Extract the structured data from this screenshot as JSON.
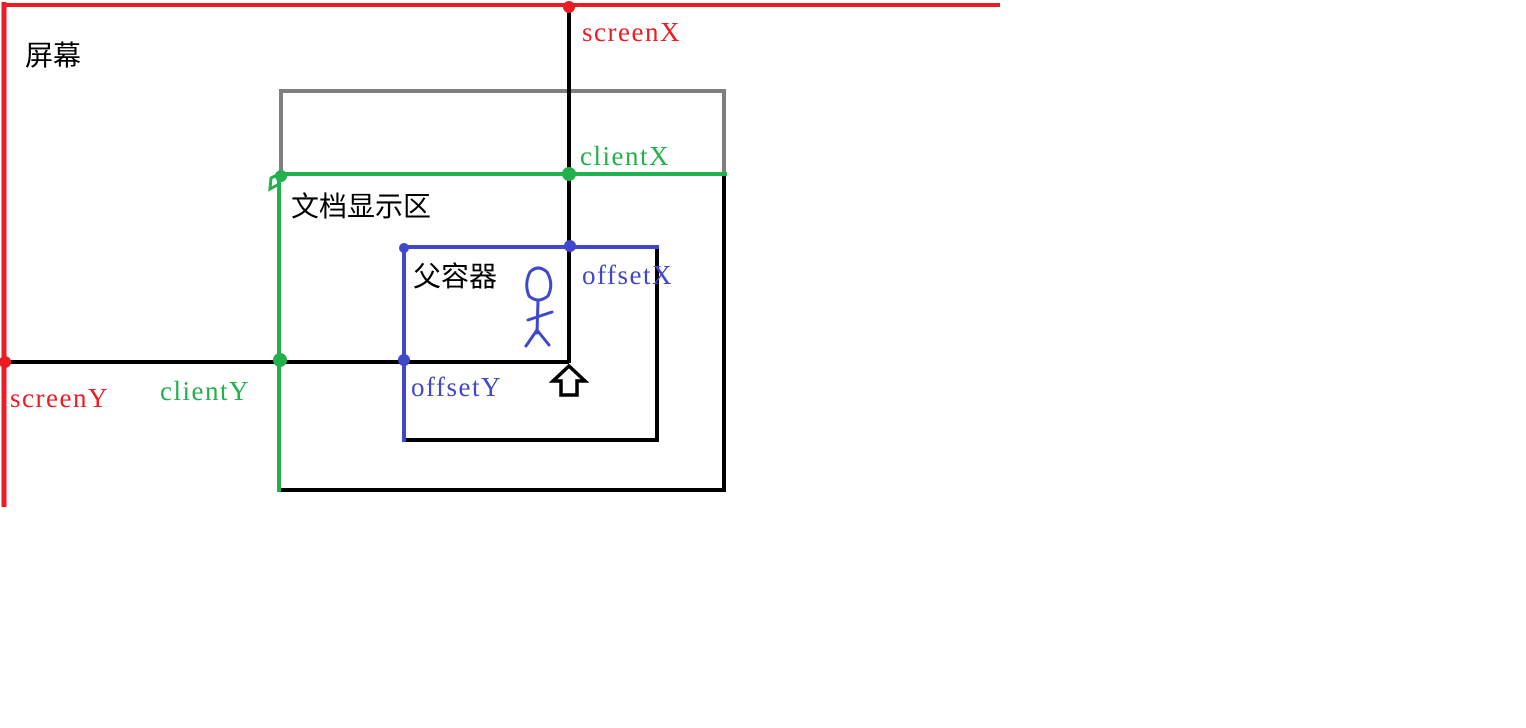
{
  "labels": {
    "screen": "屏幕",
    "document_area": "文档显示区",
    "parent_container": "父容器",
    "screenX": "screenX",
    "screenY": "screenY",
    "clientX": "clientX",
    "clientY": "clientY",
    "offsetX": "offsetX",
    "offsetY": "offsetY"
  },
  "colors": {
    "screen": "#ed1c24",
    "client": "#22b14c",
    "offset": "#3f48cc",
    "window_frame": "#7f7f7f",
    "axis": "#000000"
  },
  "icons": {
    "person": "stick-figure-icon",
    "cursor": "arrow-cursor-icon"
  }
}
